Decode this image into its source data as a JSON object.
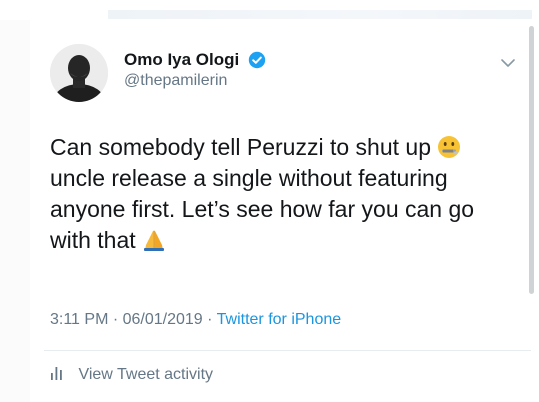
{
  "tweet": {
    "display_name": "Omo Iya Ologi",
    "handle": "@thepamilerin",
    "line1": "Can somebody tell Peruzzi to shut up",
    "line2": "uncle release a single without featuring",
    "line3": "anyone first. Let’s see how far you can go",
    "line4": "with that",
    "timestamp": "3:11 PM · 06/01/2019",
    "separator": "·",
    "source": "Twitter for iPhone",
    "activity_label": "View Tweet activity"
  },
  "icons": {
    "verified": "verified-badge-icon",
    "menu": "chevron-down-icon",
    "zipper_emoji": "zipper-mouth-face-emoji",
    "pray_emoji": "folded-hands-emoji",
    "activity": "bar-chart-icon"
  },
  "colors": {
    "text": "#14171a",
    "secondary": "#657786",
    "link": "#1b95e0",
    "verified": "#1da1f2",
    "divider": "#e6ecf0"
  }
}
